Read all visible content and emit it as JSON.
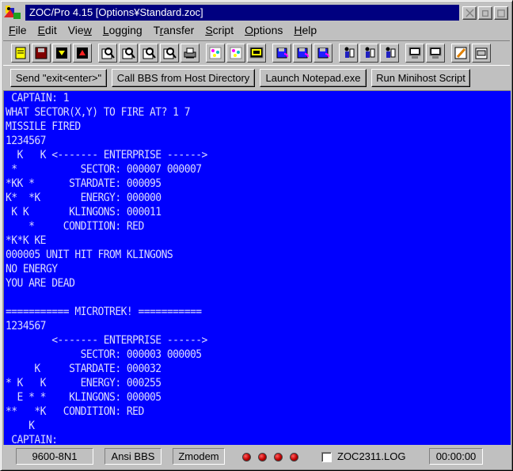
{
  "window": {
    "title": "ZOC/Pro 4.15 [Options¥Standard.zoc]"
  },
  "menu": [
    {
      "label": "File",
      "accel": "F",
      "rest": "ile"
    },
    {
      "label": "Edit",
      "accel": "E",
      "rest": "dit"
    },
    {
      "label": "View",
      "pre": "Vie",
      "accel": "w",
      "rest": ""
    },
    {
      "label": "Logging",
      "accel": "L",
      "rest": "ogging"
    },
    {
      "label": "Transfer",
      "pre": "T",
      "accel": "r",
      "rest": "ansfer"
    },
    {
      "label": "Script",
      "accel": "S",
      "rest": "cript"
    },
    {
      "label": "Options",
      "accel": "O",
      "rest": "ptions"
    },
    {
      "label": "Help",
      "accel": "H",
      "rest": "elp"
    }
  ],
  "toolbar_icons": [
    "notebook-icon",
    "disk-icon",
    "download-icon",
    "upload-icon",
    "search-icon",
    "search-icon",
    "search-icon",
    "search-icon",
    "printer-icon",
    "sparkle-icon",
    "sparkle-icon",
    "terminal-icon",
    "disk-color-icon",
    "disk-color-icon",
    "disk-color-icon",
    "people-icon",
    "people-icon",
    "people-icon",
    "computer-icon",
    "computer-icon",
    "pencil-icon",
    "clipboard-icon"
  ],
  "buttons": [
    "Send \"exit<enter>\"",
    "Call BBS from Host Directory",
    "Launch Notepad.exe",
    "Run Minihost Script"
  ],
  "terminal": {
    "colors": {
      "background": "#0000ff",
      "text": "#dcdcff"
    },
    "lines": [
      " CAPTAIN: 1",
      "WHAT SECTOR(X,Y) TO FIRE AT? 1 7",
      "MISSILE FIRED",
      "1234567",
      "  K   K <------- ENTERPRISE ------>",
      " *           SECTOR: 000007 000007",
      "*KK *      STARDATE: 000095",
      "K*  *K       ENERGY: 000000",
      " K K       KLINGONS: 000011",
      "    *     CONDITION: RED",
      "*K*K KE",
      "000005 UNIT HIT FROM KLINGONS",
      "NO ENERGY",
      "YOU ARE DEAD",
      "",
      "=========== MICROTREK! ===========",
      "1234567",
      "        <------- ENTERPRISE ------>",
      "             SECTOR: 000003 000005",
      "     K     STARDATE: 000032",
      "* K   K      ENERGY: 000255",
      "  E * *    KLINGONS: 000005",
      "**   *K   CONDITION: RED",
      "    K",
      " CAPTAIN: _"
    ]
  },
  "status": {
    "baud": "9600-8N1",
    "emulation": "Ansi BBS",
    "transfer": "Zmodem",
    "log_file": "ZOC2311.LOG",
    "timer": "00:00:00"
  }
}
